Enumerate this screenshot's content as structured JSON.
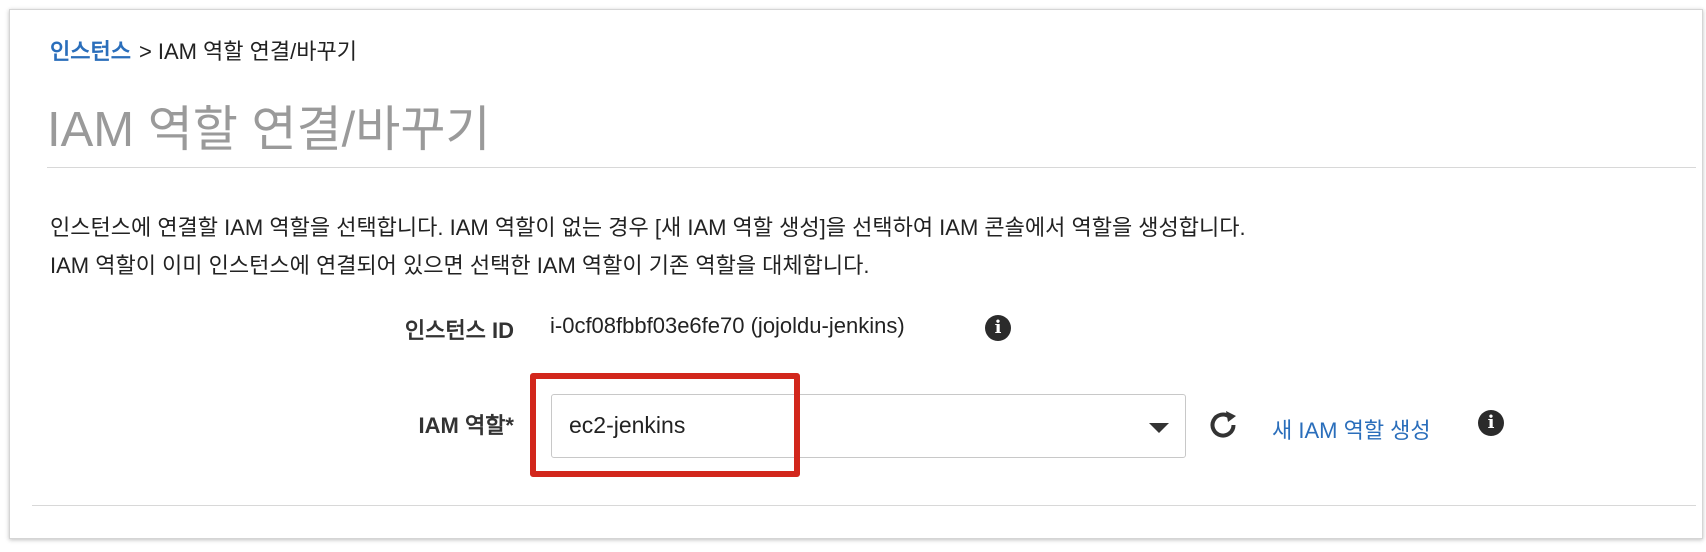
{
  "breadcrumb": {
    "link_label": "인스턴스",
    "separator": ">",
    "current": "IAM 역할 연결/바꾸기"
  },
  "page": {
    "title": "IAM 역할 연결/바꾸기"
  },
  "description": {
    "line1": "인스턴스에 연결할 IAM 역할을 선택합니다. IAM 역할이 없는 경우 [새 IAM 역할 생성]을 선택하여 IAM 콘솔에서 역할을 생성합니다.",
    "line2": "IAM 역할이 이미 인스턴스에 연결되어 있으면 선택한 IAM 역할이 기존 역할을 대체합니다."
  },
  "form": {
    "instance_label": "인스턴스 ID",
    "instance_value": "i-0cf08fbbf03e6fe70 (jojoldu-jenkins)",
    "role_label": "IAM 역할*",
    "role_selected": "ec2-jenkins",
    "new_role_link": "새 IAM 역할 생성",
    "info_glyph": "i"
  },
  "icons": {
    "info": "info-icon",
    "refresh": "refresh-icon",
    "dropdown": "chevron-down-icon"
  },
  "colors": {
    "link": "#2a6ebb",
    "title": "#9a9a9a",
    "highlight": "#d2271c"
  }
}
